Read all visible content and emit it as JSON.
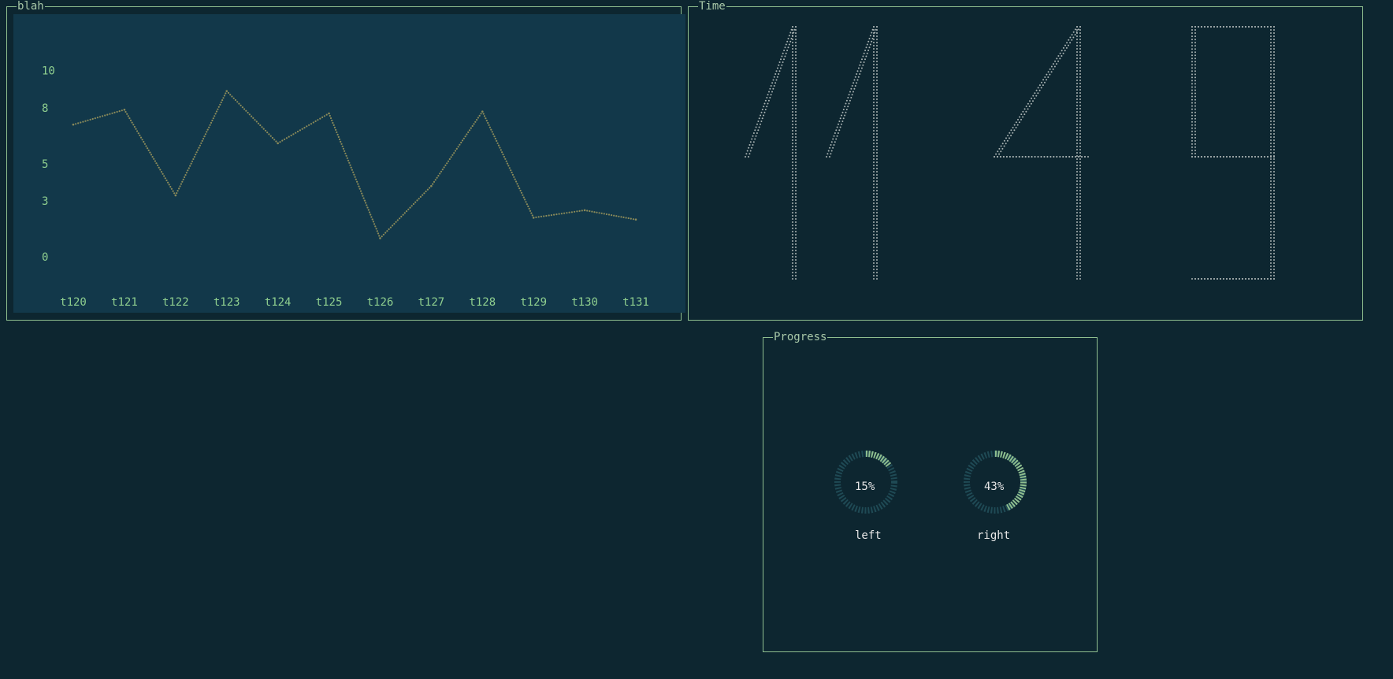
{
  "panels": {
    "chart_title": "blah",
    "time_title": "Time",
    "progress_title": "Progress"
  },
  "chart_data": {
    "type": "line",
    "title": "blah",
    "xlabel": "",
    "ylabel": "",
    "categories": [
      "t120",
      "t121",
      "t122",
      "t123",
      "t124",
      "t125",
      "t126",
      "t127",
      "t128",
      "t129",
      "t130",
      "t131"
    ],
    "y_ticks": [
      "0",
      "3",
      "5",
      "8",
      "10"
    ],
    "ylim": [
      0,
      11
    ],
    "series": [
      {
        "values": [
          7.1,
          7.9,
          3.3,
          8.9,
          6.1,
          7.7,
          1.0,
          3.8,
          7.8,
          2.1,
          2.5,
          2.0
        ]
      }
    ],
    "colors": {
      "line": "#8a8a5a",
      "ticks": "#8fcf8f"
    }
  },
  "time": {
    "display": "11:49",
    "digits": [
      "1",
      "1",
      "4",
      "9"
    ]
  },
  "progress": {
    "gauges": [
      {
        "label": "left",
        "value_text": "15%",
        "value": 0.15
      },
      {
        "label": "right",
        "value_text": "43%",
        "value": 0.43
      }
    ],
    "colors": {
      "fill": "#8fbf8f",
      "track": "#1f4a55",
      "text": "#e6e6e6"
    }
  }
}
